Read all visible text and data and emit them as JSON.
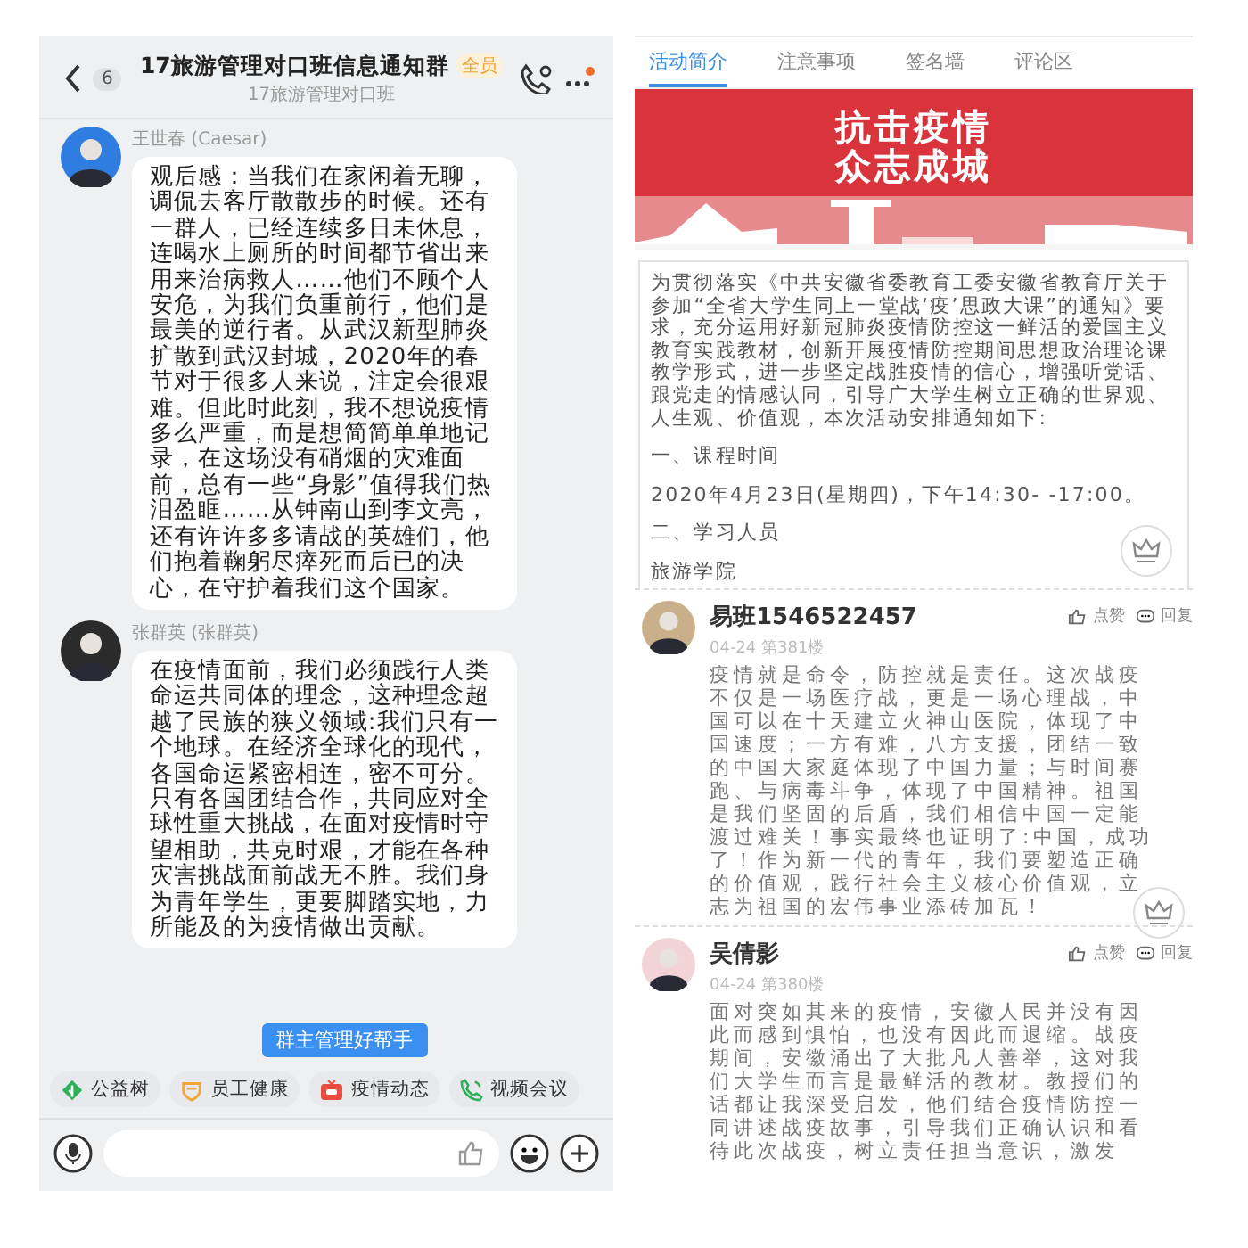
{
  "chat": {
    "unread": "6",
    "title": "17旅游管理对口班信息通知群",
    "tag": "全员",
    "subtitle": "17旅游管理对口班",
    "messages": [
      {
        "sender": "王世春 (Caesar)",
        "text": "观后感：当我们在家闲着无聊，调侃去客厅散散步的时候。还有一群人，已经连续多日未休息，连喝水上厕所的时间都节省出来用来治病救人……他们不顾个人安危，为我们负重前行，他们是最美的逆行者。从武汉新型肺炎扩散到武汉封城，2020年的春节对于很多人来说，注定会很艰难。但此时此刻，我不想说疫情多么严重，而是想简简单单地记录，在这场没有硝烟的灾难面前，总有一些“身影”值得我们热泪盈眶……从钟南山到李文亮，还有许许多多请战的英雄们，他们抱着鞠躬尽瘁死而后已的决心，在守护着我们这个国家。"
      },
      {
        "sender": "张群英 (张群英)",
        "text": "在疫情面前，我们必须践行人类命运共同体的理念，这种理念超越了民族的狭义领域:我们只有一个地球。在经济全球化的现代，各国命运紧密相连，密不可分。只有各国团结合作，共同应对全球性重大挑战，在面对疫情时守望相助，共克时艰，才能在各种灾害挑战面前战无不胜。我们身为青年学生，更要脚踏实地，力所能及的为疫情做出贡献。"
      }
    ],
    "tooltip": "群主管理好帮手",
    "shortcuts": [
      {
        "label": "公益树",
        "kind": "tree"
      },
      {
        "label": "员工健康",
        "kind": "heart"
      },
      {
        "label": "疫情动态",
        "kind": "news"
      },
      {
        "label": "视频会议",
        "kind": "call"
      }
    ]
  },
  "activity": {
    "tabs": [
      {
        "label": "活动简介",
        "selected": true
      },
      {
        "label": "注意事项",
        "selected": false
      },
      {
        "label": "签名墙",
        "selected": false
      },
      {
        "label": "评论区",
        "selected": false
      }
    ],
    "banner": [
      "抗击疫情",
      "众志成城"
    ],
    "article": [
      "为贯彻落实《中共安徽省委教育工委安徽省教育厅关于参加“全省大学生同上一堂战‘疫’思政大课”的通知》要求，充分运用好新冠肺炎疫情防控这一鲜活的爱国主义教育实践教材，创新开展疫情防控期间思想政治理论课教学形式，进一步坚定战胜疫情的信心，增强听党话、跟党走的情感认同，引导广大学生树立正确的世界观、人生观、价值观，本次活动安排通知如下:",
      "一、课程时间",
      "2020年4月23日(星期四)，下午14:30- -17:00。",
      "二、学习人员",
      "旅游学院"
    ],
    "comments": [
      {
        "name": "易班1546522457",
        "like": "点赞",
        "reply": "回复",
        "meta": "04-24 第381楼",
        "text": "疫情就是命令，防控就是责任。这次战疫不仅是一场医疗战，更是一场心理战，中国可以在十天建立火神山医院，体现了中国速度；一方有难，八方支援，团结一致的中国大家庭体现了中国力量；与时间赛跑、与病毒斗争，体现了中国精神。祖国是我们坚固的后盾，我们相信中国一定能渡过难关！事实最终也证明了:中国，成功了！作为新一代的青年，我们要塑造正确的价值观，践行社会主义核心价值观，立志为祖国的宏伟事业添砖加瓦！"
      },
      {
        "name": "吴倩影",
        "like": "点赞",
        "reply": "回复",
        "meta": "04-24 第380楼",
        "text": "面对突如其来的疫情，安徽人民并没有因此而感到惧怕，也没有因此而退缩。战疫期间，安徽涌出了大批凡人善举，这对我们大学生而言是最鲜活的教材。教授们的话都让我深受启发，他们结合疫情防控一同讲述战疫故事，引导我们正确认识和看待此次战疫，树立责任担当意识，激发"
      }
    ]
  }
}
